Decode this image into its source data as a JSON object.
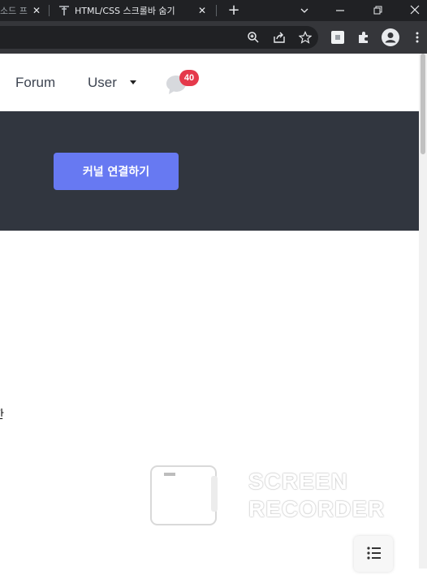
{
  "browser": {
    "tabs": [
      {
        "title": "소드 프",
        "active": false
      },
      {
        "title": "HTML/CSS 스크롤바 숨기",
        "active": true
      }
    ],
    "icons": {
      "close": "close-icon",
      "new_tab": "plus-icon",
      "zoom": "zoom-in-icon",
      "share": "share-icon",
      "bookmark": "star-icon",
      "extension": "extension-icon",
      "puzzle": "puzzle-icon",
      "profile": "avatar-icon",
      "menu": "kebab-menu-icon"
    },
    "colors": {
      "titlebar": "#202124",
      "toolbar": "#35363a"
    }
  },
  "site": {
    "nav": {
      "forum": "Forum",
      "user": "User"
    },
    "notifications": {
      "count": "40"
    },
    "hero": {
      "button_label": "커널 연결하기"
    },
    "partial_text": "한",
    "colors": {
      "hero_bg": "#31363f",
      "button": "#6779f2",
      "badge": "#e5394b"
    }
  },
  "watermark": {
    "line1": "SCREEN",
    "line2": "RECORDER"
  }
}
